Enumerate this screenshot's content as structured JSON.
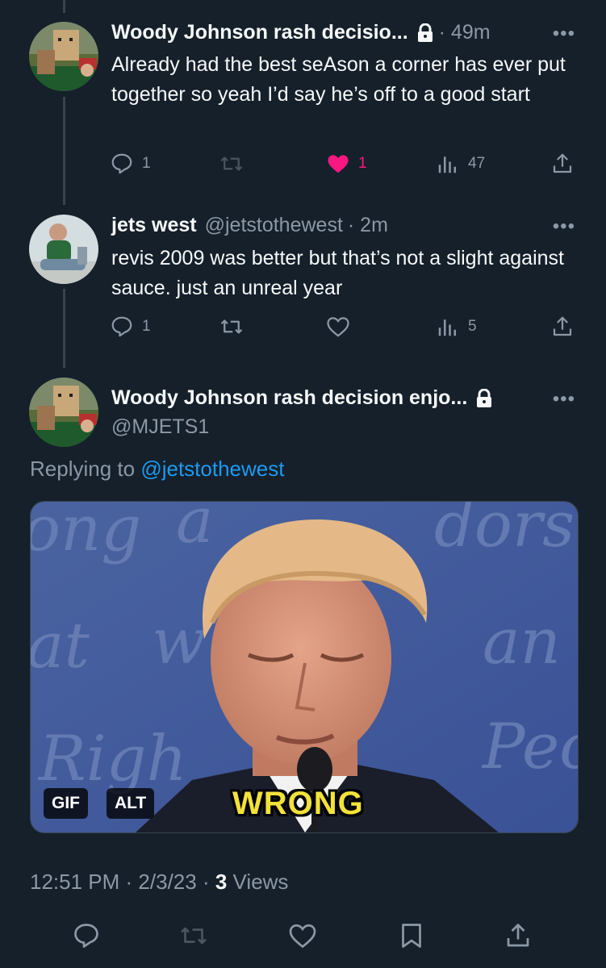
{
  "tweets": [
    {
      "display_name": "Woody Johnson rash decisio...",
      "time": "· 49m",
      "text": "Already had the best seAson a corner has ever put together so yeah I’d say he’s off to a good start",
      "replies": "1",
      "likes": "1",
      "views": "47",
      "liked": true,
      "protected": true
    },
    {
      "display_name": "jets west",
      "handle": "@jetstothewest",
      "time": "· 2m",
      "text": "revis 2009 was better but that’s not a slight against sauce. just an unreal year",
      "replies": "1",
      "views": "5",
      "liked": false
    }
  ],
  "focused": {
    "display_name": "Woody Johnson rash decision enjo...",
    "handle": "@MJETS1",
    "replying_to_label": "Replying to",
    "replying_to_handle": "@jetstothewest",
    "media": {
      "gif_badge": "GIF",
      "alt_badge": "ALT",
      "caption": "WRONG",
      "background_text": [
        "ong",
        "a",
        "dors",
        "at",
        "w",
        "an",
        "Righ",
        "Peo"
      ]
    },
    "time": "12:51 PM",
    "date": "2/3/23",
    "views_count": "3",
    "views_label": "Views"
  },
  "icons": {
    "reply": "reply-icon",
    "retweet": "retweet-icon",
    "like": "heart-icon",
    "views": "views-icon",
    "share": "share-icon",
    "bookmark": "bookmark-icon",
    "lock": "lock-icon",
    "more": "more-icon"
  },
  "colors": {
    "background": "#15202b",
    "text": "#f7f9f9",
    "muted": "#8b98a5",
    "link": "#1d9bf0",
    "like": "#f91880",
    "divider": "#38444d"
  }
}
